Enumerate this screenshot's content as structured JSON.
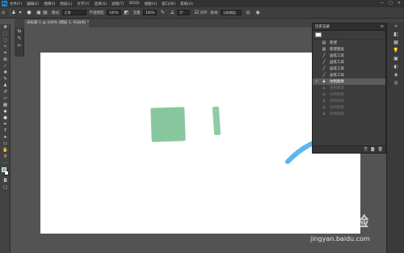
{
  "menubar": {
    "logo": "Ps",
    "items": [
      "文件(F)",
      "编辑(E)",
      "图像(I)",
      "图层(L)",
      "文字(Y)",
      "选择(S)",
      "滤镜(T)",
      "3D(D)",
      "视图(V)",
      "窗口(W)",
      "帮助(H)"
    ],
    "window_controls": [
      "—",
      "□",
      "✕"
    ]
  },
  "options": {
    "mode_label": "模式:",
    "mode_value": "正常",
    "opacity_label": "不透明度:",
    "opacity_value": "100%",
    "flow_label": "流量:",
    "flow_value": "100%",
    "smooth_value": "0°",
    "sample_label": "对齐",
    "sample_source_label": "样本:",
    "sample_source_value": "当前图层"
  },
  "document": {
    "tab_label": "未标题-1 @ 100% (图层 1, RGB/8) *"
  },
  "history": {
    "title": "历史记录",
    "rows": [
      {
        "label": "新建",
        "icon": "document-icon",
        "state": "normal"
      },
      {
        "label": "新建图层",
        "icon": "layer-icon",
        "state": "normal"
      },
      {
        "label": "画笔工具",
        "icon": "brush-icon",
        "state": "normal"
      },
      {
        "label": "画笔工具",
        "icon": "brush-icon",
        "state": "normal"
      },
      {
        "label": "画笔工具",
        "icon": "brush-icon",
        "state": "normal"
      },
      {
        "label": "画笔工具",
        "icon": "brush-icon",
        "state": "normal"
      },
      {
        "label": "仿制图章",
        "icon": "stamp-icon",
        "state": "selected"
      },
      {
        "label": "仿制图章",
        "icon": "stamp-icon",
        "state": "undone"
      },
      {
        "label": "仿制图章",
        "icon": "stamp-icon",
        "state": "undone"
      },
      {
        "label": "仿制图章",
        "icon": "stamp-icon",
        "state": "undone"
      },
      {
        "label": "仿制图章",
        "icon": "stamp-icon",
        "state": "undone"
      },
      {
        "label": "仿制图章",
        "icon": "stamp-icon",
        "state": "undone"
      }
    ]
  },
  "canvas": {
    "shape_color": "#88c79e",
    "arrow_color": "#5ab7ef"
  },
  "swatches": {
    "foreground": "#7dbf91",
    "background": "#ffffff"
  },
  "watermark": {
    "main": "Bai 经验",
    "url": "jingyan.baidu.com"
  }
}
